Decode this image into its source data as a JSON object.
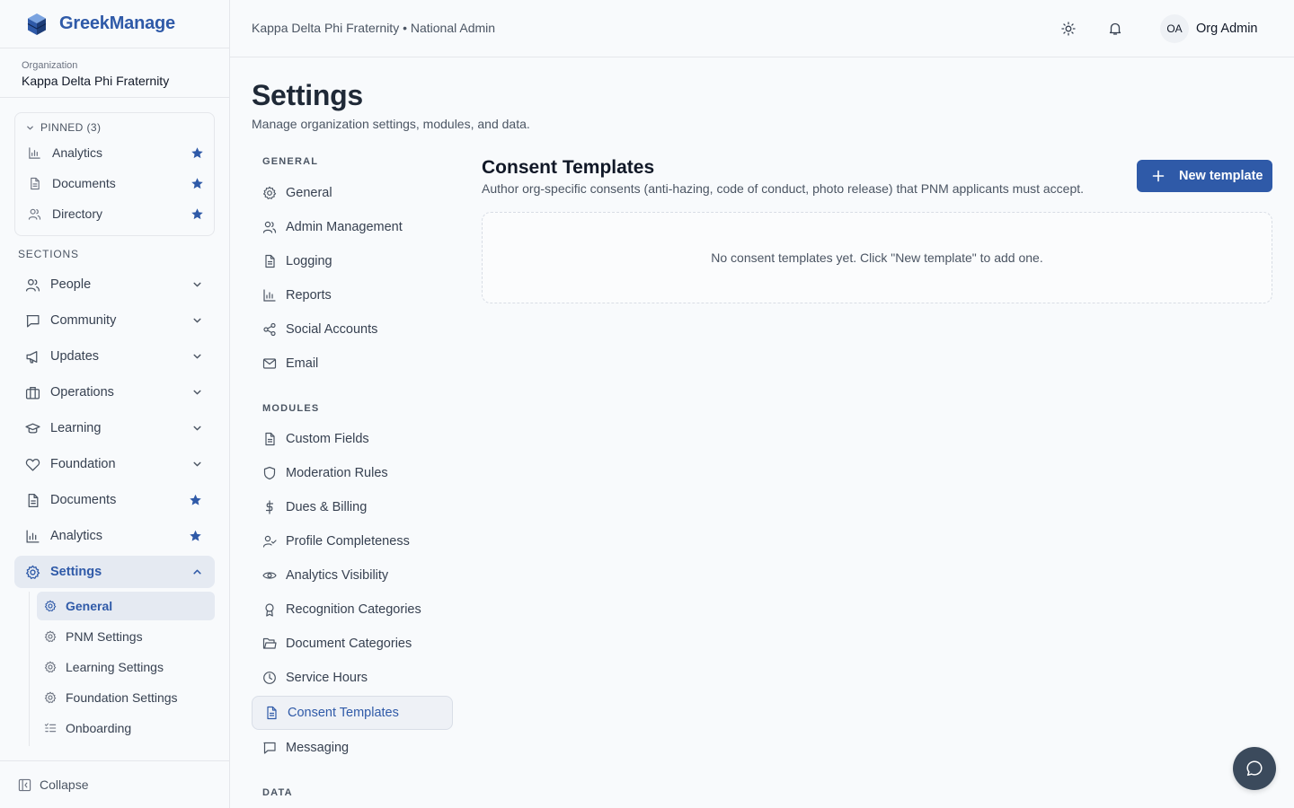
{
  "brand": {
    "name": "GreekManage"
  },
  "organization": {
    "label": "Organization",
    "name": "Kappa Delta Phi Fraternity"
  },
  "pinned": {
    "title": "PINNED (3)",
    "items": [
      {
        "label": "Analytics",
        "icon": "bar-chart-icon"
      },
      {
        "label": "Documents",
        "icon": "document-icon"
      },
      {
        "label": "Directory",
        "icon": "users-icon"
      }
    ]
  },
  "sections": {
    "title": "SECTIONS",
    "items": [
      {
        "label": "People",
        "icon": "users-icon",
        "trail": "chevron-down"
      },
      {
        "label": "Community",
        "icon": "chat-icon",
        "trail": "chevron-down"
      },
      {
        "label": "Updates",
        "icon": "megaphone-icon",
        "trail": "chevron-down"
      },
      {
        "label": "Operations",
        "icon": "briefcase-icon",
        "trail": "chevron-down"
      },
      {
        "label": "Learning",
        "icon": "graduation-cap-icon",
        "trail": "chevron-down"
      },
      {
        "label": "Foundation",
        "icon": "heart-icon",
        "trail": "chevron-down"
      },
      {
        "label": "Documents",
        "icon": "document-icon",
        "trail": "star"
      },
      {
        "label": "Analytics",
        "icon": "bar-chart-icon",
        "trail": "star"
      },
      {
        "label": "Settings",
        "icon": "gear-icon",
        "trail": "chevron-up",
        "active": true
      }
    ],
    "settings_sub": [
      {
        "label": "General",
        "icon": "gear-icon",
        "active": true
      },
      {
        "label": "PNM Settings",
        "icon": "gear-icon"
      },
      {
        "label": "Learning Settings",
        "icon": "gear-icon"
      },
      {
        "label": "Foundation Settings",
        "icon": "gear-icon"
      },
      {
        "label": "Onboarding",
        "icon": "checklist-icon"
      }
    ]
  },
  "collapse_label": "Collapse",
  "topbar": {
    "breadcrumb": "Kappa Delta Phi Fraternity • National Admin",
    "user_initials": "OA",
    "user_name": "Org Admin"
  },
  "page": {
    "title": "Settings",
    "subtitle": "Manage organization settings, modules, and data."
  },
  "settings_nav": {
    "general_title": "GENERAL",
    "general": [
      {
        "label": "General",
        "icon": "gear-icon"
      },
      {
        "label": "Admin Management",
        "icon": "users-icon"
      },
      {
        "label": "Logging",
        "icon": "document-icon"
      },
      {
        "label": "Reports",
        "icon": "bar-chart-icon"
      },
      {
        "label": "Social Accounts",
        "icon": "share-icon"
      },
      {
        "label": "Email",
        "icon": "mail-icon"
      }
    ],
    "modules_title": "MODULES",
    "modules": [
      {
        "label": "Custom Fields",
        "icon": "document-icon"
      },
      {
        "label": "Moderation Rules",
        "icon": "shield-icon"
      },
      {
        "label": "Dues & Billing",
        "icon": "dollar-icon"
      },
      {
        "label": "Profile Completeness",
        "icon": "user-check-icon"
      },
      {
        "label": "Analytics Visibility",
        "icon": "eye-icon"
      },
      {
        "label": "Recognition Categories",
        "icon": "award-icon"
      },
      {
        "label": "Document Categories",
        "icon": "folder-icon"
      },
      {
        "label": "Service Hours",
        "icon": "clock-icon"
      },
      {
        "label": "Consent Templates",
        "icon": "document-icon",
        "active": true
      },
      {
        "label": "Messaging",
        "icon": "chat-icon"
      }
    ],
    "data_title": "DATA"
  },
  "content": {
    "title": "Consent Templates",
    "subtitle": "Author org-specific consents (anti-hazing, code of conduct, photo release) that PNM applicants must accept.",
    "new_button": "New template",
    "empty_message": "No consent templates yet. Click \"New template\" to add one."
  },
  "colors": {
    "accent": "#2f5aa8",
    "star": "#2f5aa8",
    "chat_button": "#3b4a5c"
  }
}
